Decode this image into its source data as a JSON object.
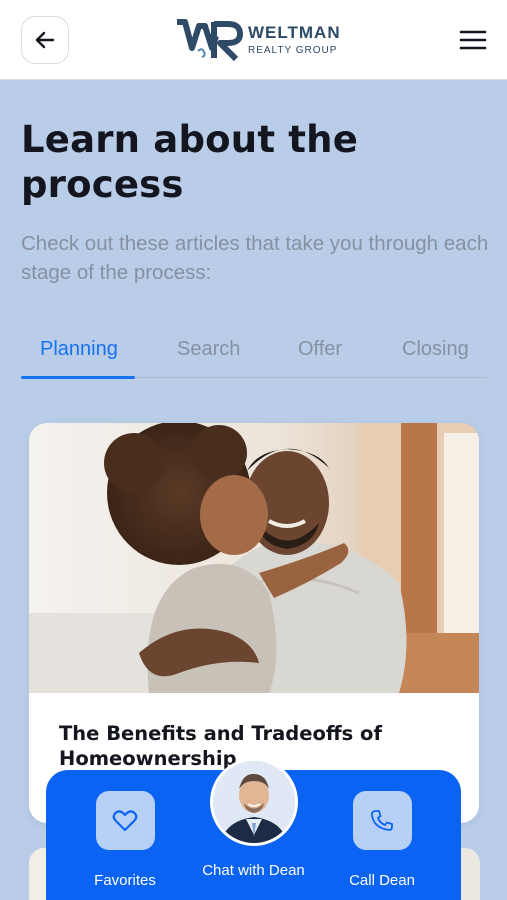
{
  "header": {
    "logo_initials": "WR",
    "logo_name": "WELTMAN",
    "logo_subtitle": "REALTY GROUP",
    "back_icon": "arrow-left-icon",
    "menu_icon": "hamburger-menu-icon"
  },
  "main": {
    "title": "Learn about the process",
    "subtitle": "Check out these articles that take you through each stage of the process:"
  },
  "tabs": [
    {
      "label": "Planning",
      "active": true
    },
    {
      "label": "Search",
      "active": false
    },
    {
      "label": "Offer",
      "active": false
    },
    {
      "label": "Closing",
      "active": false
    }
  ],
  "article": {
    "title": "The Benefits and Tradeoffs of Homeownership",
    "image_icon": "father-daughter-photo"
  },
  "action_bar": {
    "favorites_label": "Favorites",
    "chat_label": "Chat with Dean",
    "call_label": "Call Dean",
    "favorites_icon": "heart-icon",
    "call_icon": "phone-icon",
    "avatar_icon": "agent-avatar"
  },
  "colors": {
    "accent": "#1672f0",
    "action_bar": "#0b63f3",
    "background": "#b9cde8",
    "brand_navy": "#2e4a66"
  }
}
